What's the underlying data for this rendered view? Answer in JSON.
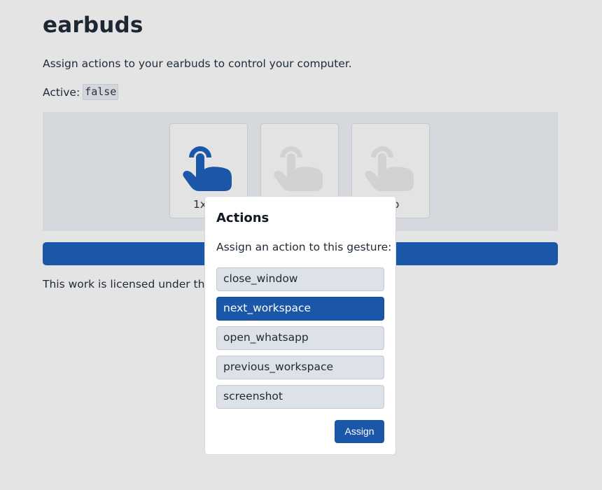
{
  "app": {
    "title": "earbuds",
    "subtitle": "Assign actions to your earbuds to control your computer.",
    "active_label": "Active:",
    "active_value": "false"
  },
  "gestures": [
    {
      "label": "1x",
      "icon": "tap-finger-icon",
      "state": "selected"
    },
    {
      "label": "",
      "icon": "tap-finger-icon",
      "state": "disabled"
    },
    {
      "label": "ap",
      "icon": "tap-finger-icon",
      "state": "disabled"
    }
  ],
  "colors": {
    "accent": "#1b57a8",
    "icon_disabled": "#d2d2d2",
    "background": "#e4e4e4"
  },
  "footer": {
    "license_text": "This work is licensed under the"
  },
  "dialog": {
    "title": "Actions",
    "prompt": "Assign an action to this gesture:",
    "options": [
      {
        "label": "close_window",
        "selected": false
      },
      {
        "label": "next_workspace",
        "selected": true
      },
      {
        "label": "open_whatsapp",
        "selected": false
      },
      {
        "label": "previous_workspace",
        "selected": false
      },
      {
        "label": "screenshot",
        "selected": false
      }
    ],
    "assign_label": "Assign"
  }
}
